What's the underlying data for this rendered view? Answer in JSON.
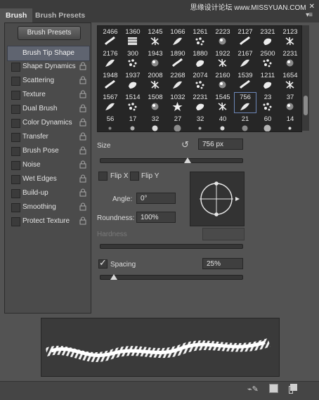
{
  "tabs": [
    {
      "label": "Brush",
      "active": true
    },
    {
      "label": "Brush Presets",
      "active": false
    }
  ],
  "watermark": "思缘设计论坛  www.MISSYUAN.COM",
  "presets_button": "Brush Presets",
  "tip_shape": "Brush Tip Shape",
  "options": [
    {
      "label": "Shape Dynamics",
      "locked": true
    },
    {
      "label": "Scattering",
      "locked": true
    },
    {
      "label": "Texture",
      "locked": true
    },
    {
      "label": "Dual Brush",
      "locked": true
    },
    {
      "label": "Color Dynamics",
      "locked": true
    },
    {
      "label": "Transfer",
      "locked": true
    },
    {
      "label": "Brush Pose",
      "locked": true
    },
    {
      "label": "Noise",
      "locked": true
    },
    {
      "label": "Wet Edges",
      "locked": true
    },
    {
      "label": "Build-up",
      "locked": true
    },
    {
      "label": "Smoothing",
      "locked": true
    },
    {
      "label": "Protect Texture",
      "locked": true
    }
  ],
  "brushes": [
    [
      "2466",
      "1360",
      "1245",
      "1066",
      "1261",
      "2223",
      "2127",
      "2321",
      "2123"
    ],
    [
      "2176",
      "300",
      "1943",
      "1890",
      "1880",
      "1922",
      "2167",
      "2500",
      "2231"
    ],
    [
      "1948",
      "1937",
      "2008",
      "2268",
      "2074",
      "2160",
      "1539",
      "1211",
      "1654"
    ],
    [
      "1567",
      "1514",
      "1508",
      "1032",
      "2231",
      "1545",
      "756",
      "23",
      "37"
    ],
    [
      "56",
      "17",
      "32",
      "27",
      "32",
      "40",
      "21",
      "60",
      "14"
    ]
  ],
  "selected_brush": "756",
  "size": {
    "label": "Size",
    "value": "756 px",
    "level": 0.62
  },
  "flip_x": "Flip X",
  "flip_y": "Flip Y",
  "angle": {
    "label": "Angle:",
    "value": "0°"
  },
  "roundness": {
    "label": "Roundness:",
    "value": "100%"
  },
  "hardness": {
    "label": "Hardness"
  },
  "spacing": {
    "label": "Spacing",
    "value": "25%",
    "checked": true,
    "level": 0.1
  },
  "colors": {
    "panel": "#535353",
    "dark": "#262626",
    "highlight": "#5f6470"
  }
}
